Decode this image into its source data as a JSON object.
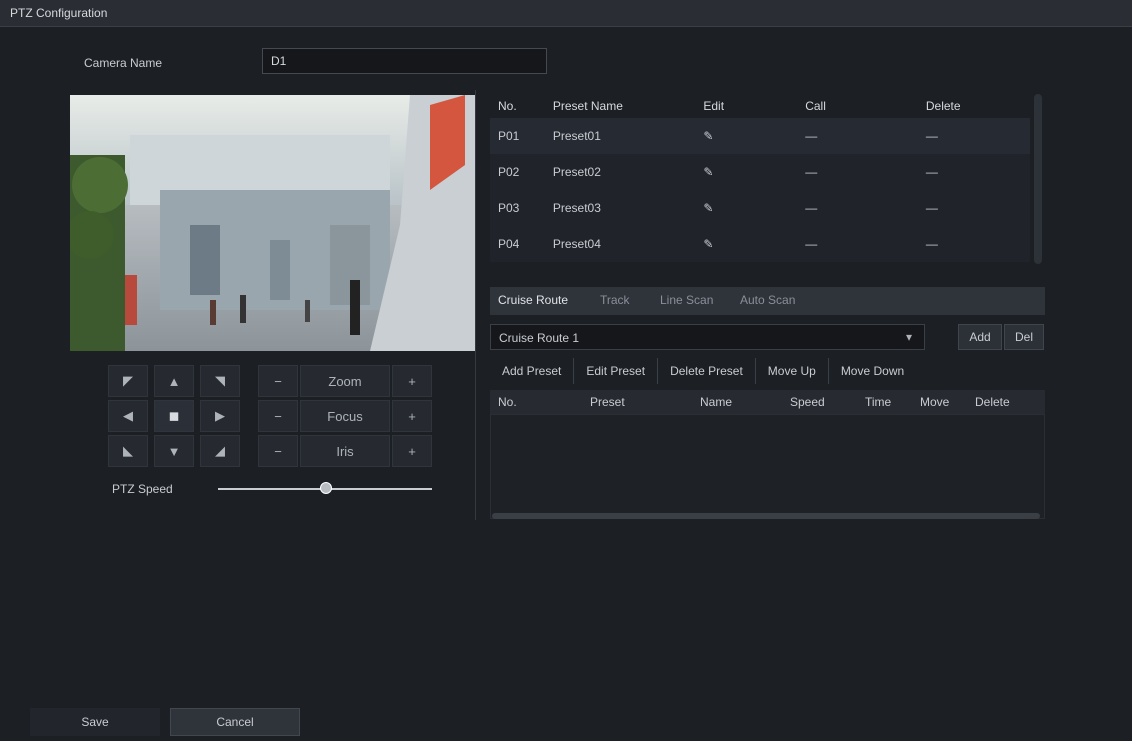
{
  "window": {
    "title": "PTZ Configuration"
  },
  "camera": {
    "label": "Camera Name",
    "value": "D1"
  },
  "ptz": {
    "buttons": [
      "◤",
      "▲",
      "◥",
      "◀",
      "◼",
      "▶",
      "◣",
      "▼",
      "◢"
    ],
    "zoom_label": "Zoom",
    "focus_label": "Focus",
    "iris_label": "Iris",
    "speed_label": "PTZ Speed",
    "speed_fraction": 0.5
  },
  "preset_table": {
    "headers": [
      "No.",
      "Preset Name",
      "Edit",
      "Call",
      "Delete"
    ],
    "rows": [
      {
        "no": "P01",
        "name": "Preset01",
        "edit": "✎",
        "call": "—",
        "delete": "—"
      },
      {
        "no": "P02",
        "name": "Preset02",
        "edit": "✎",
        "call": "—",
        "delete": "—"
      },
      {
        "no": "P03",
        "name": "Preset03",
        "edit": "✎",
        "call": "—",
        "delete": "—"
      },
      {
        "no": "P04",
        "name": "Preset04",
        "edit": "✎",
        "call": "—",
        "delete": "—"
      }
    ]
  },
  "tabs": [
    {
      "label": "Cruise Route"
    },
    {
      "label": "Track"
    },
    {
      "label": "Line Scan"
    },
    {
      "label": "Auto Scan"
    }
  ],
  "cruise": {
    "selected": "Cruise Route 1",
    "btn_add": "Add",
    "btn_delete": "Del",
    "toolbar": [
      "Add Preset",
      "Edit Preset",
      "Delete Preset",
      "Move Up",
      "Move Down"
    ],
    "grid_headers": [
      "No.",
      "Preset",
      "Name",
      "Speed",
      "Time",
      "Move",
      "Delete"
    ]
  },
  "footer": {
    "save": "Save",
    "cancel": "Cancel"
  }
}
